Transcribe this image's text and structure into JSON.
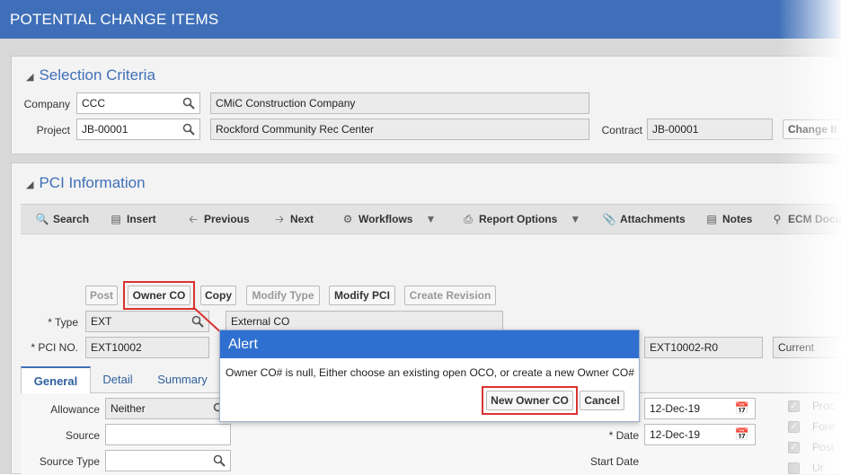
{
  "header": {
    "title": "POTENTIAL CHANGE ITEMS"
  },
  "selection": {
    "title": "Selection Criteria",
    "company_label": "Company",
    "company_code": "CCC",
    "company_name": "CMiC Construction Company",
    "project_label": "Project",
    "project_code": "JB-00001",
    "project_name": "Rockford Community Rec Center",
    "contract_label": "Contract",
    "contract_value": "JB-00001",
    "change_label": "Change It"
  },
  "pci": {
    "title": "PCI Information",
    "toolbar": {
      "search": "Search",
      "insert": "Insert",
      "previous": "Previous",
      "next": "Next",
      "workflows": "Workflows",
      "report_options": "Report Options",
      "attachments": "Attachments",
      "notes": "Notes",
      "ecm": "ECM Docu"
    },
    "buttons": {
      "post": "Post",
      "owner_co": "Owner CO",
      "copy": "Copy",
      "modify_type": "Modify Type",
      "modify_pci": "Modify PCI",
      "create_revision": "Create Revision"
    },
    "type_label": "* Type",
    "type_code": "EXT",
    "type_name": "External CO",
    "pci_no_label": "* PCI NO.",
    "pci_no": "EXT10002",
    "revision": "EXT10002-R0",
    "status": "Current",
    "tabs": [
      "General",
      "Detail",
      "Summary"
    ],
    "allowance_label": "Allowance",
    "allowance_value": "Neither",
    "source_label": "Source",
    "source_type_label": "Source Type",
    "date1": "12-Dec-19",
    "date_label": "* Date",
    "date2": "12-Dec-19",
    "start_date_label": "Start Date",
    "checks": [
      "Proc",
      "Fore",
      "Post",
      "Ur"
    ]
  },
  "alert": {
    "title": "Alert",
    "message": "Owner CO# is null, Either choose an existing open OCO, or create a new Owner CO#",
    "new_owner_co": "New Owner CO",
    "cancel": "Cancel"
  },
  "colors": {
    "header_blue": "#3f6fb8",
    "alert_blue": "#2f6fcf",
    "highlight_red": "#d9332f"
  }
}
